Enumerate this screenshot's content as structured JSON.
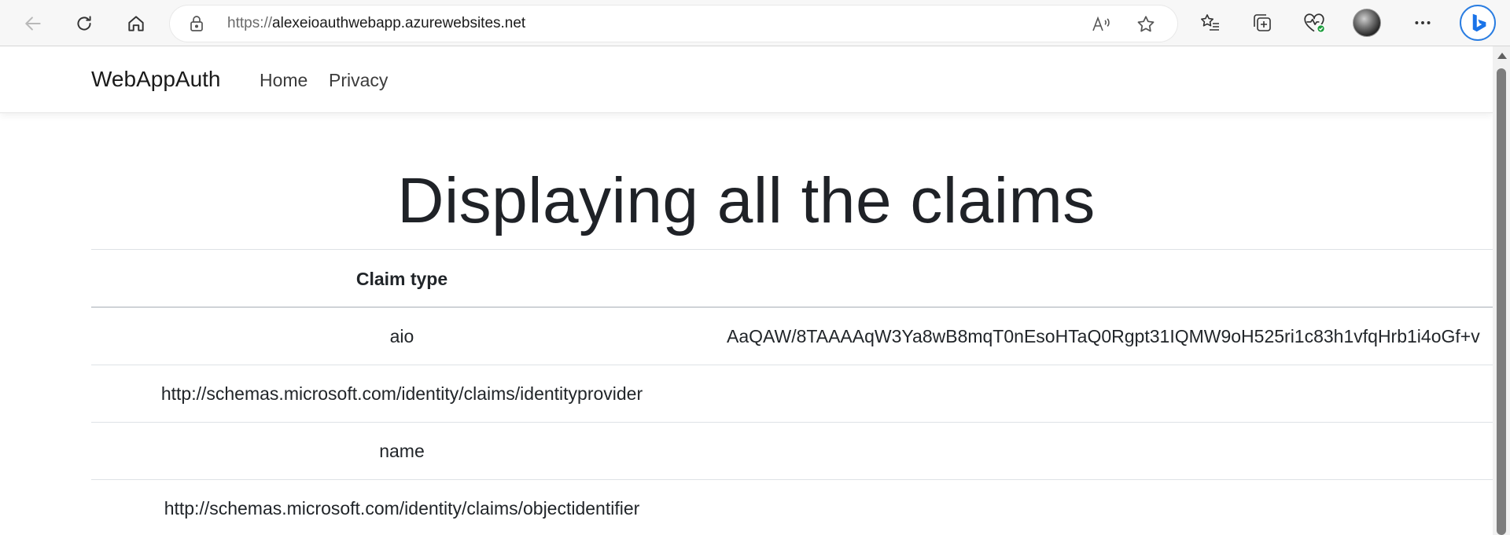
{
  "browser": {
    "url_scheme": "https://",
    "url_host": "alexeioauthwebapp.azurewebsites.net"
  },
  "navbar": {
    "brand": "WebAppAuth",
    "links": [
      "Home",
      "Privacy"
    ]
  },
  "page": {
    "heading": "Displaying all the claims"
  },
  "table": {
    "header_claim_type": "Claim type",
    "rows": [
      {
        "type": "aio",
        "value": "AaQAW/8TAAAAqW3Ya8wB8mqT0nEsoHTaQ0Rgpt31IQMW9oH525ri1c83h1vfqHrb1i4oGf+v"
      },
      {
        "type": "http://schemas.microsoft.com/identity/claims/identityprovider",
        "value": ""
      },
      {
        "type": "name",
        "value": ""
      },
      {
        "type": "http://schemas.microsoft.com/identity/claims/objectidentifier",
        "value": ""
      }
    ]
  },
  "icons": {
    "back": "back-arrow-icon",
    "refresh": "refresh-icon",
    "home": "home-icon",
    "lock": "lock-icon",
    "read_aloud": "read-aloud-icon",
    "favorite": "star-icon",
    "favorites": "favorites-list-icon",
    "collections": "collections-icon",
    "health": "browser-essentials-icon",
    "more": "more-icon",
    "copilot": "bing-icon"
  }
}
